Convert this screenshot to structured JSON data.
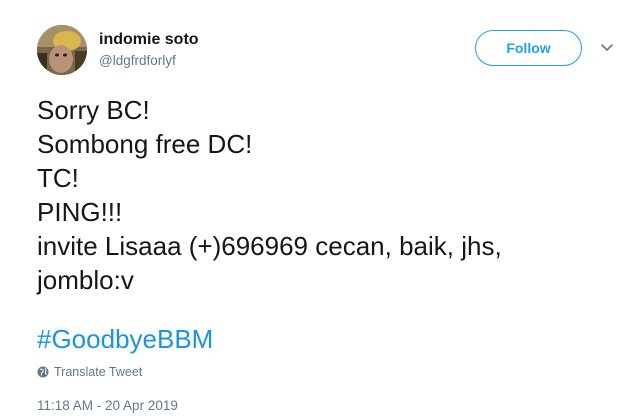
{
  "user": {
    "display_name": "indomie soto",
    "handle": "@ldgfrdforlyf"
  },
  "actions": {
    "follow_label": "Follow"
  },
  "tweet": {
    "lines": [
      "Sorry BC!",
      "Sombong free DC!",
      "TC!",
      "PING!!!",
      "invite Lisaaa (+)696969 cecan, baik, jhs,",
      "jomblo:v"
    ],
    "hashtag": "#GoodbyeBBM",
    "translate_label": "Translate Tweet",
    "timestamp": "11:18 AM - 20 Apr 2019"
  },
  "colors": {
    "accent": "#1da1f2",
    "hashtag": "#1b95e0",
    "secondary_text": "#657786"
  },
  "icons": {
    "translate": "globe-icon",
    "more": "chevron-down-icon"
  }
}
